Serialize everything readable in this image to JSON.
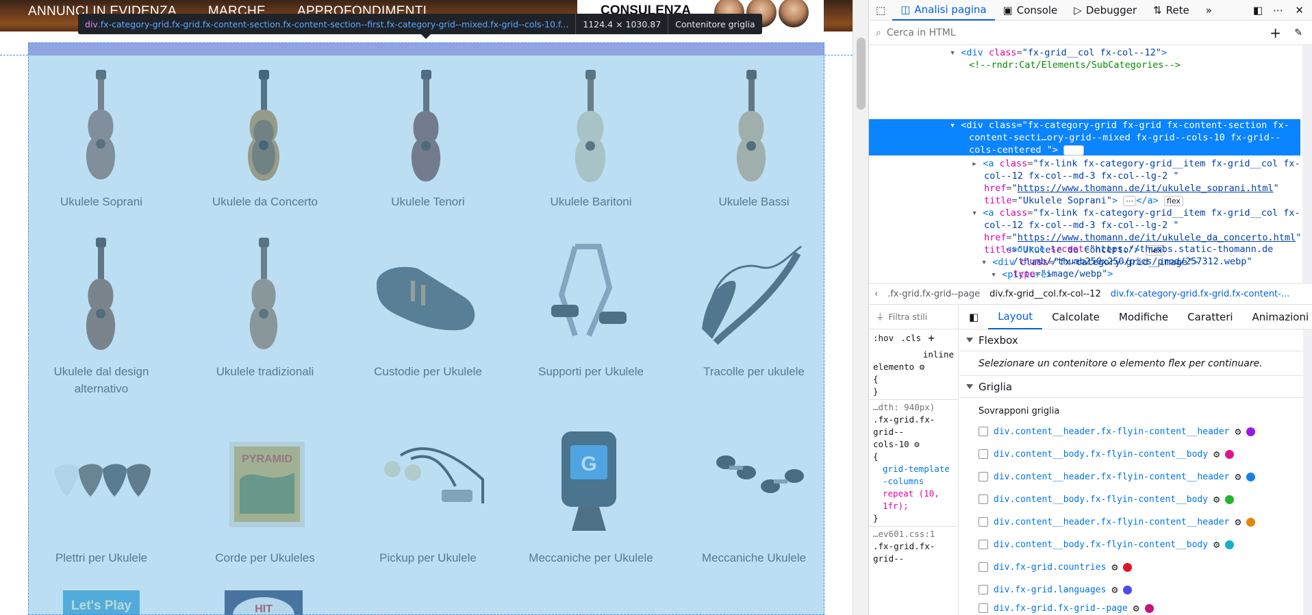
{
  "page": {
    "nav": [
      "ANNUNCI IN EVIDENZA",
      "MARCHE",
      "APPROFONDIMENTI"
    ],
    "consulenza_label": "CONSULENZA",
    "categories": [
      {
        "name": "Ukulele Soprani",
        "icon": "ukulele-image"
      },
      {
        "name": "Ukulele da Concerto",
        "icon": "ukulele-image"
      },
      {
        "name": "Ukulele Tenori",
        "icon": "ukulele-image"
      },
      {
        "name": "Ukulele Baritoni",
        "icon": "ukulele-image"
      },
      {
        "name": "Ukulele Bassi",
        "icon": "ukulele-image"
      },
      {
        "name": "Ukulele dal design alternativo",
        "icon": "ukulele-image"
      },
      {
        "name": "Ukulele tradizionali",
        "icon": "ukulele-image"
      },
      {
        "name": "Custodie per Ukulele",
        "icon": "case-image"
      },
      {
        "name": "Supporti per Ukulele",
        "icon": "stand-image"
      },
      {
        "name": "Tracolle per ukulele",
        "icon": "strap-image"
      },
      {
        "name": "Plettri per Ukulele",
        "icon": "picks-image"
      },
      {
        "name": "Corde per Ukuleles",
        "icon": "strings-image"
      },
      {
        "name": "Pickup per Ukulele",
        "icon": "pickup-image"
      },
      {
        "name": "Meccaniche per Ukulele",
        "icon": "tuner-image"
      },
      {
        "name": "Meccaniche Ukulele",
        "icon": "tuning-pegs-image"
      }
    ],
    "strings_pack_brand": "PYRAMID",
    "book_title": "Let's Play",
    "hit_book_title": "HIT"
  },
  "tooltip": {
    "selector_tag": "div",
    "selector_rest": ".fx-category-grid.fx-grid.fx-content-section.fx-content-section--first.fx-category-grid--mixed.fx-grid--cols-10.f...",
    "dimensions": "1124.4 × 1030.87",
    "kind": "Contenitore griglia"
  },
  "devtools": {
    "tabs": [
      "Analisi pagina",
      "Console",
      "Debugger",
      "Rete"
    ],
    "active_tab": "Analisi pagina",
    "search_placeholder": "Cerca in HTML",
    "code": {
      "line1_class": "fx-grid__col fx-col--12",
      "comment": "<!--rndr:Cat/Elements/SubCategories-->",
      "sel_class_1": "fx-category-grid fx-grid fx-content-section fx-",
      "sel_class_2": "content-secti…ory-grid--mixed fx-grid--cols-10 fx-grid--",
      "sel_class_3": "cols-centered ",
      "grid_badge": "grid",
      "a1_class_1": "fx-link fx-category-grid__item fx-grid__col fx-",
      "a1_class_2": "col--12 fx-col--md-3 fx-col--lg-2 ",
      "a1_href": "https://www.thomann.de/it/ukulele_soprani.html",
      "a1_title": "Ukulele Soprani",
      "flex_badge": "flex",
      "a2_class_1": "fx-link fx-category-grid__item fx-grid__col fx-",
      "a2_class_2": "col--12 fx-col--md-3 fx-col--lg-2 ",
      "a2_href": "https://www.thomann.de/it/ukulele_da_concerto.html",
      "a2_title": "Ukulele da Concerto",
      "div_image_class": "fx-category-grid__image",
      "picture_tag": "picture",
      "source_srcset_1": "https://thumbs.static-thomann.de",
      "source_srcset_2": "/thumb//thumb250x250/pics/prod/257312.webp",
      "source_type": "image/webp"
    },
    "breadcrumbs": [
      ".fx-grid.fx-grid--page",
      "div.fx-grid__col.fx-col--12",
      "div.fx-category-grid.fx-grid.fx-content-..."
    ],
    "filter_placeholder": "Filtra stili",
    "pseudo": ":hov",
    "cls": ".cls",
    "rules": {
      "inline": "inline",
      "elemento": "elemento",
      "open": "{",
      "close": "}",
      "media": "…dth: 940px)",
      "selector_1": ".fx-grid.fx-",
      "selector_2": "grid--",
      "selector_3": "cols-10",
      "prop": "grid-template-columns",
      "value": "repeat (10, 1fr);",
      "source": "…ev601.css:1",
      "selector_b1": ".fx-grid.fx-",
      "selector_b2": "grid--"
    },
    "layout_tabs": [
      "Layout",
      "Calcolate",
      "Modifiche",
      "Caratteri",
      "Animazioni"
    ],
    "flexbox_title": "Flexbox",
    "flexbox_hint": "Selezionare un contenitore o elemento flex per continuare.",
    "grid_title": "Griglia",
    "overlay_title": "Sovrapponi griglia",
    "grid_items": [
      {
        "label": "div.content__header.fx-flyin-content__header",
        "color": "#9b16e6"
      },
      {
        "label": "div.content__body.fx-flyin-content__body",
        "color": "#e0138f"
      },
      {
        "label": "div.content__header.fx-flyin-content__header",
        "color": "#1a7fe8"
      },
      {
        "label": "div.content__body.fx-flyin-content__body",
        "color": "#1fb52f"
      },
      {
        "label": "div.content__header.fx-flyin-content__header",
        "color": "#e8840c"
      },
      {
        "label": "div.content__body.fx-flyin-content__body",
        "color": "#11b3c4"
      },
      {
        "label": "div.fx-grid.countries",
        "color": "#e0132b"
      },
      {
        "label": "div.fx-grid.languages",
        "color": "#4a4de8"
      },
      {
        "label": "div.fx-grid.fx-grid--page",
        "color": "#c4137a"
      }
    ]
  }
}
